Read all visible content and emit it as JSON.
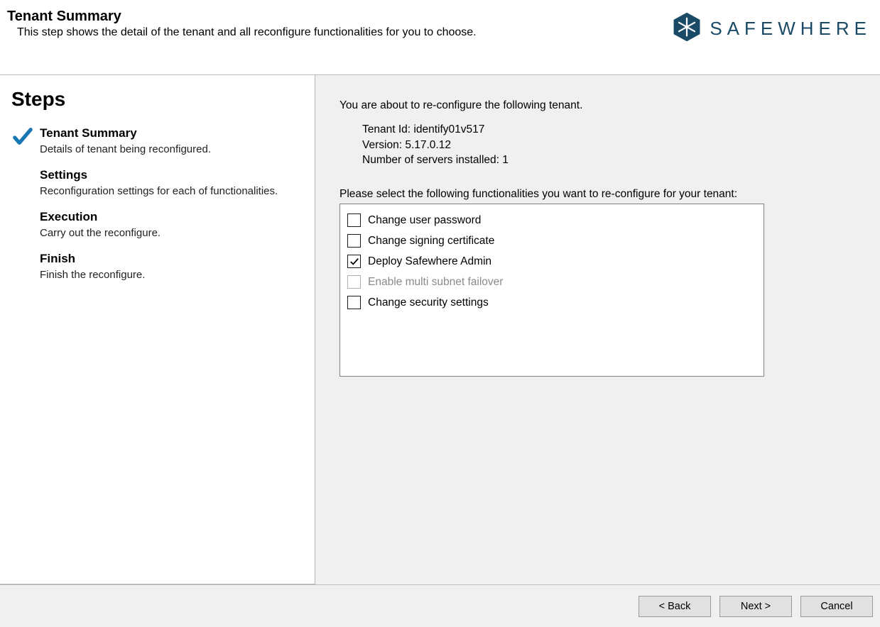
{
  "header": {
    "title": "Tenant Summary",
    "subtitle": "This step shows the detail of the tenant and all reconfigure functionalities for you to choose.",
    "brand": "SAFEWHERE"
  },
  "steps": {
    "heading": "Steps",
    "items": [
      {
        "title": "Tenant Summary",
        "desc": "Details of tenant being reconfigured.",
        "active": true
      },
      {
        "title": "Settings",
        "desc": "Reconfiguration settings for each of functionalities.",
        "active": false
      },
      {
        "title": "Execution",
        "desc": "Carry out the reconfigure.",
        "active": false
      },
      {
        "title": "Finish",
        "desc": "Finish the reconfigure.",
        "active": false
      }
    ]
  },
  "main": {
    "intro": "You are about to re-configure the following tenant.",
    "tenant": {
      "id_label": "Tenant Id:",
      "id": "identify01v517",
      "version_label": "Version:",
      "version": "5.17.0.12",
      "servers_label": "Number of servers installed:",
      "servers": "1"
    },
    "select_prompt": "Please select the following functionalities you want to re-configure for your tenant:",
    "functions": [
      {
        "label": "Change user password",
        "checked": false,
        "disabled": false
      },
      {
        "label": "Change signing certificate",
        "checked": false,
        "disabled": false
      },
      {
        "label": "Deploy Safewhere Admin",
        "checked": true,
        "disabled": false
      },
      {
        "label": "Enable multi subnet failover",
        "checked": false,
        "disabled": true
      },
      {
        "label": "Change security settings",
        "checked": false,
        "disabled": false
      }
    ]
  },
  "buttons": {
    "back": "< Back",
    "next": "Next >",
    "cancel": "Cancel"
  }
}
